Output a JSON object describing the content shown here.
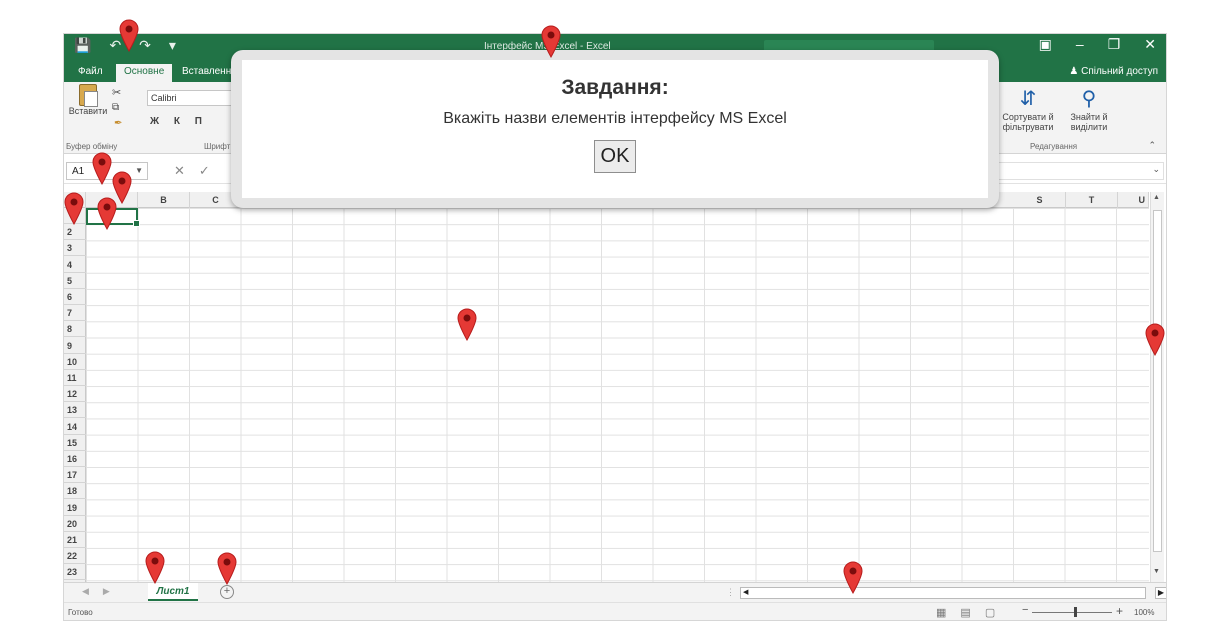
{
  "window": {
    "title": "Інтерфейс MS Excel - Excel",
    "share": "Спільний доступ"
  },
  "tabs": [
    {
      "label": "Файл"
    },
    {
      "label": "Основне"
    },
    {
      "label": "Вставлення"
    }
  ],
  "ribbon": {
    "paste_label": "Вставити",
    "clipboard_group": "Буфер обміну",
    "font_name": "Calibri",
    "font_group": "Шрифт",
    "format_buttons": "Ж К П",
    "sort_label": "Сортувати й фільтрувати",
    "find_label": "Знайти й виділити",
    "editing_group": "Редагування"
  },
  "formula_bar": {
    "name_box": "A1"
  },
  "columns_left": [
    "B",
    "C"
  ],
  "columns_right": [
    "S",
    "T",
    "U"
  ],
  "rows": [
    "2",
    "3",
    "4",
    "5",
    "6",
    "7",
    "8",
    "9",
    "10",
    "11",
    "12",
    "13",
    "14",
    "15",
    "16",
    "17",
    "18",
    "19",
    "20",
    "21",
    "22",
    "23"
  ],
  "sheet": {
    "tab_name": "Лист1",
    "add_symbol": "+"
  },
  "status": {
    "ready": "Готово",
    "zoom": "100%"
  },
  "dialog": {
    "title": "Завдання:",
    "message": "Вкажіть назви елементів інтерфейсу MS Excel",
    "ok_label": "OK"
  },
  "colors": {
    "excel_green": "#217346",
    "marker_red": "#e53935"
  }
}
